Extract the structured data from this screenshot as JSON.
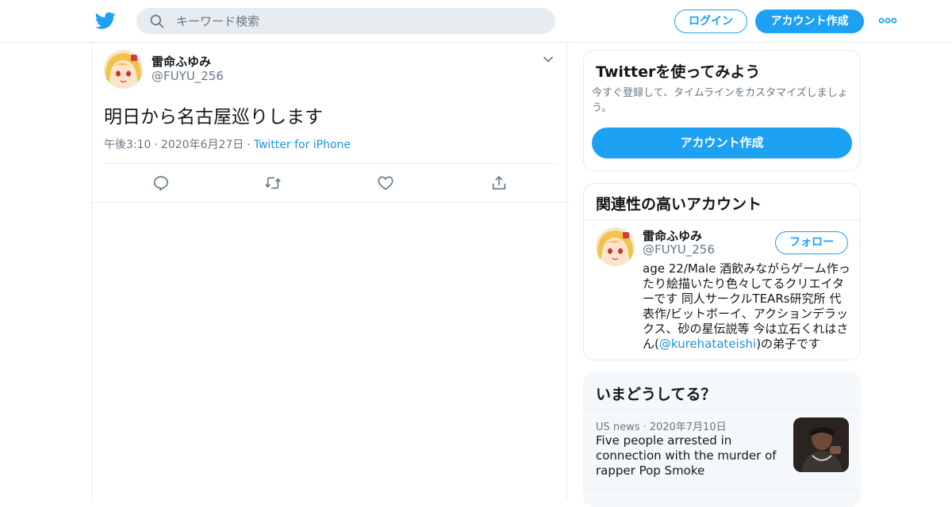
{
  "header": {
    "search_placeholder": "キーワード検索",
    "login_label": "ログイン",
    "signup_label": "アカウント作成",
    "icons": [
      "twitter-logo-icon",
      "search-icon",
      "more-icon"
    ],
    "brand_color": "#1da1f2"
  },
  "tweet": {
    "display_name": "雷命ふゆみ",
    "handle": "@FUYU_256",
    "text": "明日から名古屋巡りします",
    "time": "午後3:10",
    "date": "2020年6月27日",
    "source": "Twitter for iPhone",
    "actions": [
      "reply-icon",
      "retweet-icon",
      "like-icon",
      "share-icon"
    ]
  },
  "signup_card": {
    "title": "Twitterを使ってみよう",
    "description": "今すぐ登録して、タイムラインをカスタマイズしましょう。",
    "button_label": "アカウント作成"
  },
  "related_card": {
    "title": "関連性の高いアカウント",
    "account": {
      "display_name": "雷命ふゆみ",
      "handle": "@FUYU_256",
      "follow_label": "フォロー",
      "bio_text": "age 22/Male 酒飲みながらゲーム作ったり絵描いたり色々してるクリエイターです 同人サークルTEARs研究所 代表作/ビットボーイ、アクションデラックス、砂の星伝説等 今は立石くれはさん(",
      "bio_mention": "@kurehatateishi",
      "bio_suffix": ")の弟子です"
    }
  },
  "trends_card": {
    "title": "いまどうしてる？",
    "item": {
      "category": "US news",
      "date": "2020年7月10日",
      "headline": "Five people arrested in connection with the murder of rapper Pop Smoke"
    }
  }
}
